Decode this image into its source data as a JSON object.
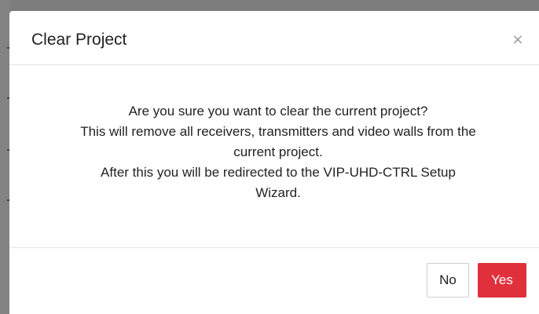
{
  "dialog": {
    "title": "Clear Project",
    "close_glyph": "×",
    "message_lines": [
      "Are you sure you want to clear the current project?",
      "This will remove all receivers, transmitters and video walls from the",
      "current project.",
      "After this you will be redirected to the VIP-UHD-CTRL Setup",
      "Wizard."
    ],
    "buttons": {
      "no_label": "No",
      "yes_label": "Yes"
    }
  },
  "colors": {
    "primary_danger": "#e0303b",
    "backdrop": "#7d7d7d"
  },
  "icons": {
    "close": "close-icon"
  }
}
